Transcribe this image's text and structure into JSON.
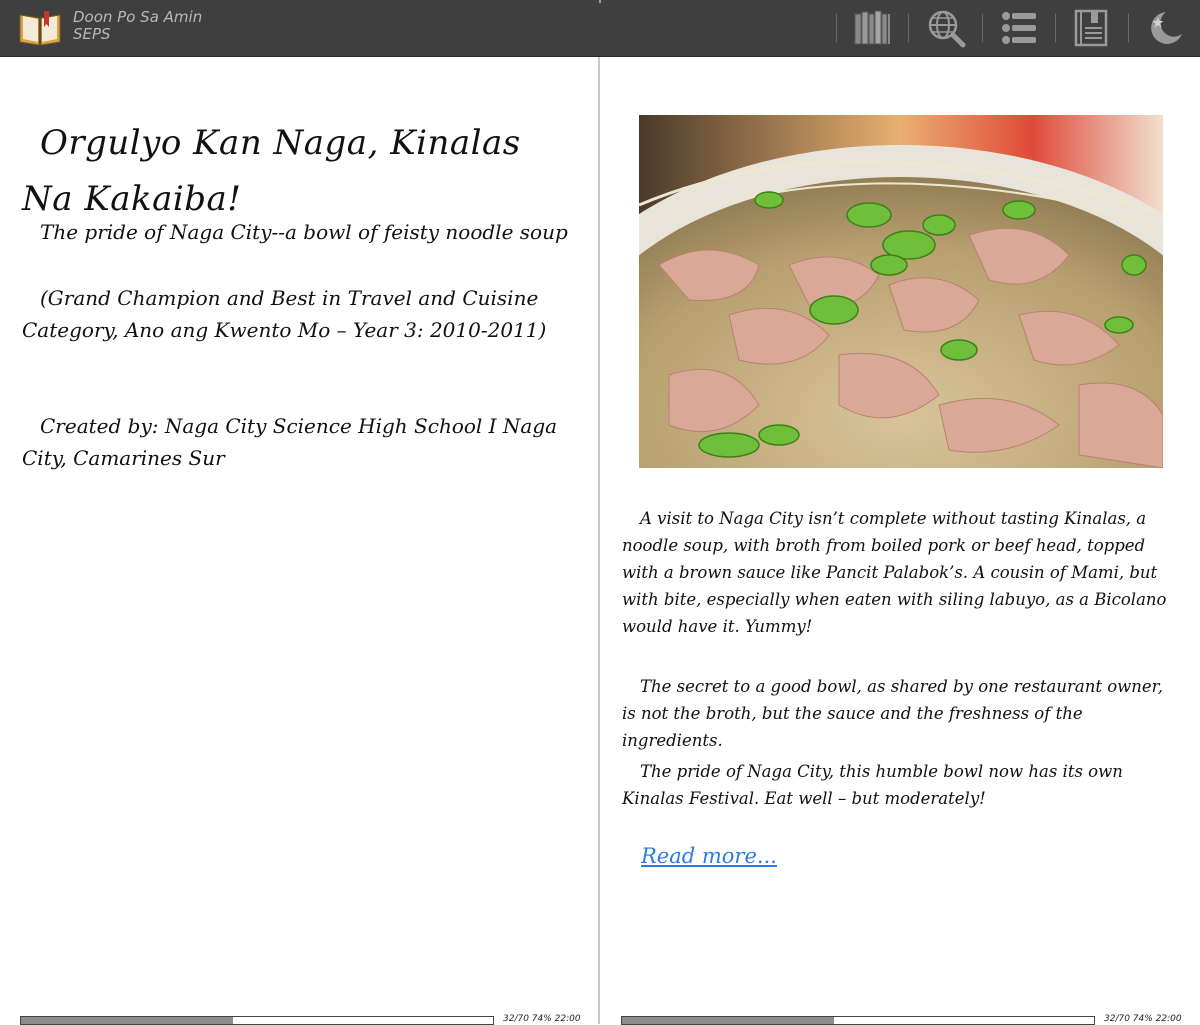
{
  "app": {
    "title_line1": "Doon Po Sa Amin",
    "title_line2": "SEPS"
  },
  "toolbar": {
    "icons": [
      "library-icon",
      "web-search-icon",
      "list-icon",
      "book-info-icon",
      "night-mode-icon"
    ]
  },
  "left_page": {
    "title": "Orgulyo Kan Naga, Kinalas Na Kakaiba!",
    "subtitle": "The pride of Naga City--a bowl of feisty noodle soup",
    "award": "(Grand Champion and Best in Travel and Cuisine Category, Ano ang Kwento Mo – Year 3: 2010-2011)",
    "creator": "Created by: Naga City Science High School I Naga City, Camarines Sur"
  },
  "right_page": {
    "paragraph1": "A visit to Naga City isn’t complete without tasting Kinalas, a noodle soup, with broth from boiled pork or beef head, topped with a brown sauce like Pancit Palabok’s. A cousin of Mami, but with bite, especially when eaten with siling labuyo, as a Bicolano would have it. Yummy!",
    "paragraph2": "The secret to a good bowl, as shared by one restaurant owner, is not the broth, but the sauce and the freshness of the ingredients.",
    "paragraph3": "The pride of Naga City, this humble bowl now has its own Kinalas Festival. Eat well – but moderately!",
    "read_more": "Read more..."
  },
  "footer": {
    "left_status": "32/70 74% 22:00",
    "right_status": "32/70 74% 22:00",
    "progress_fraction": 0.45
  },
  "colors": {
    "topbar": "#3f3f3f",
    "link": "#2c7be5",
    "progress_fill": "#8c8c8c"
  }
}
